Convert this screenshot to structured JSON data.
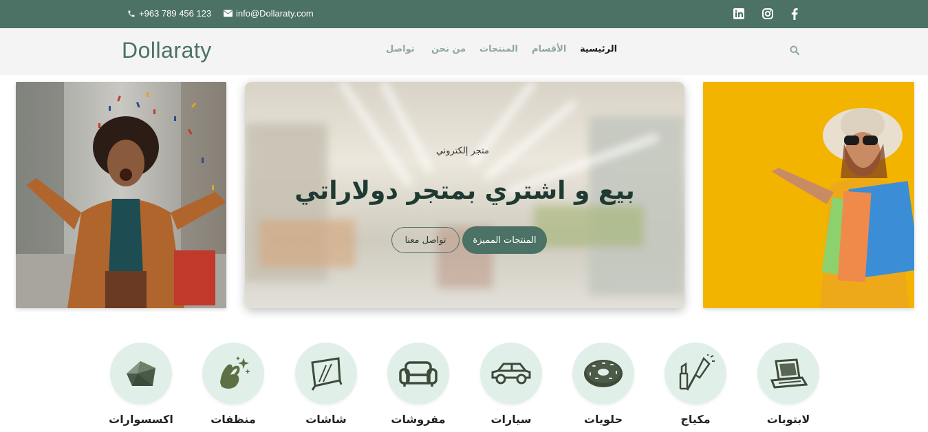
{
  "topbar": {
    "phone": "+963 789 456 123",
    "email": "info@Dollaraty.com",
    "social": [
      "linkedin-icon",
      "instagram-icon",
      "facebook-icon"
    ]
  },
  "brand": {
    "logo": "Dollaraty"
  },
  "nav": {
    "items": [
      "الرئيسية",
      "الأقسام",
      "المنتجات",
      "من نحن",
      "تواصل"
    ],
    "active": "الرئيسية"
  },
  "hero": {
    "subtitle": "متجر إلكتروني",
    "title": "بيع و اشتري بمتجر دولاراتي",
    "primary_button": "المنتجات المميزة",
    "secondary_button": "تواصل معنا"
  },
  "categories": [
    {
      "label": "اكسسوارات",
      "icon": "accessories-icon"
    },
    {
      "label": "منظفات",
      "icon": "cleaning-icon"
    },
    {
      "label": "شاشات",
      "icon": "screen-icon"
    },
    {
      "label": "مفروشات",
      "icon": "sofa-icon"
    },
    {
      "label": "سيارات",
      "icon": "car-icon"
    },
    {
      "label": "حلويات",
      "icon": "donut-icon"
    },
    {
      "label": "مكياج",
      "icon": "makeup-icon"
    },
    {
      "label": "لابتوبات",
      "icon": "laptop-icon"
    }
  ],
  "colors": {
    "primary": "#4b7264",
    "category_bg": "#e1efe9",
    "nav_bg": "#f4f4f4",
    "hero_right_bg": "#f3b400"
  }
}
